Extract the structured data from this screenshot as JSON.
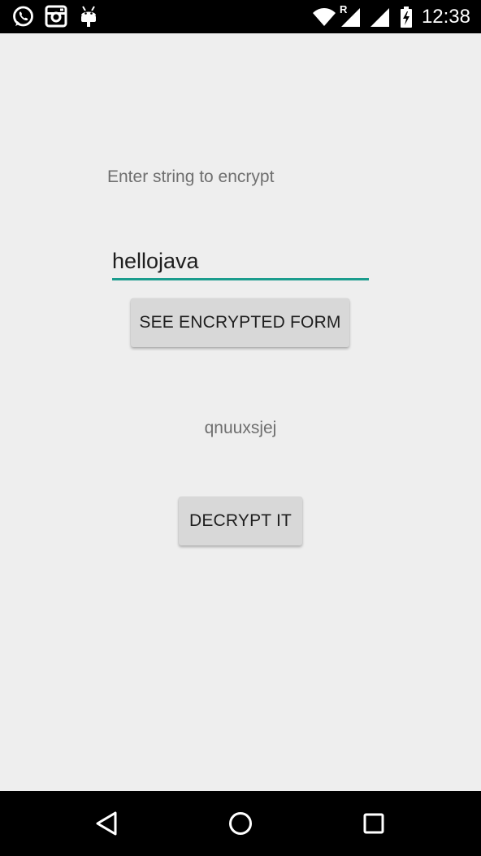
{
  "status_bar": {
    "time": "12:38",
    "left_icons": [
      "whatsapp-icon",
      "instagram-icon",
      "android-debug-icon"
    ],
    "right_icons": [
      "wifi-icon",
      "signal-roaming-icon",
      "signal-icon",
      "battery-charging-icon"
    ],
    "roaming_indicator": "R"
  },
  "main": {
    "prompt_label": "Enter string to encrypt",
    "input_value": "hellojava",
    "encrypt_button_label": "SEE ENCRYPTED FORM",
    "result_text": "qnuuxsjej",
    "decrypt_button_label": "DECRYPT IT"
  },
  "nav_bar": {
    "icons": [
      "back-icon",
      "home-icon",
      "recents-icon"
    ]
  },
  "colors": {
    "background": "#eeeeee",
    "accent": "#1b9c8d",
    "button": "#d8d8d8",
    "bars": "#000000"
  }
}
